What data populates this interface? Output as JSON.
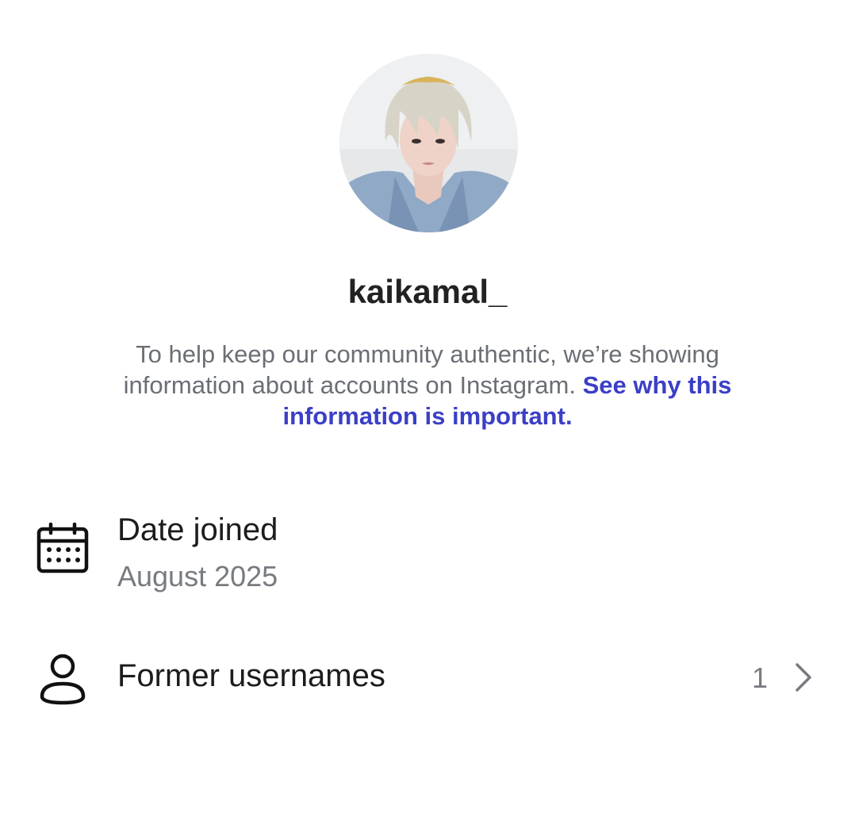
{
  "profile": {
    "username": "kaikamal_",
    "blurb_text": "To help keep our community authentic, we’re showing information about accounts on Instagram. ",
    "blurb_link": "See why this information is important."
  },
  "rows": [
    {
      "icon": "calendar-icon",
      "title": "Date joined",
      "subtitle": "August 2025"
    },
    {
      "icon": "person-icon",
      "title": "Former usernames",
      "count": "1",
      "trailing_icon": "chevron-right-icon"
    }
  ],
  "colors": {
    "link": "#3b3fc6",
    "secondary_text": "#6b6f75",
    "primary_text": "#1c1c1c"
  }
}
